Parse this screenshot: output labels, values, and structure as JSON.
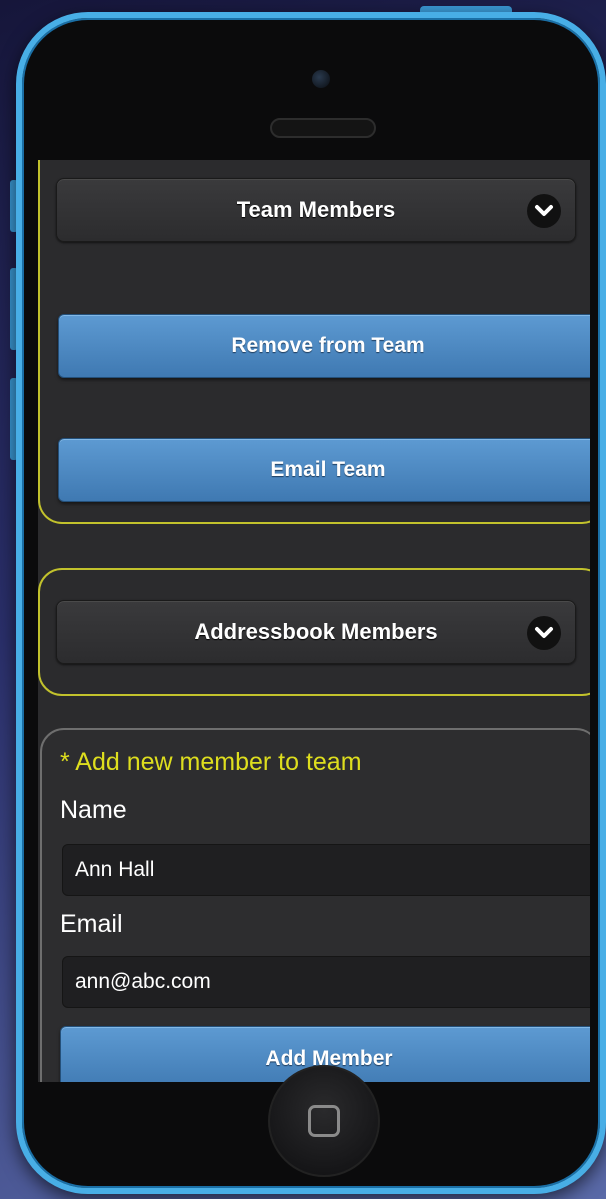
{
  "team_section": {
    "select_label": "Team Members",
    "remove_button": "Remove from Team",
    "email_button": "Email Team"
  },
  "addressbook_section": {
    "select_label": "Addressbook Members"
  },
  "add_form": {
    "title": "* Add new member to team",
    "name_label": "Name",
    "name_value": "Ann Hall",
    "email_label": "Email",
    "email_value": "ann@abc.com",
    "submit_button": "Add Member"
  },
  "colors": {
    "phone_frame": "#48aee6",
    "button_blue": "#4a86c0",
    "highlight_yellow": "#c2c22c",
    "screen_bg": "#2b2b2d"
  },
  "icons": [
    "chevron-down-icon",
    "home-square-icon"
  ]
}
